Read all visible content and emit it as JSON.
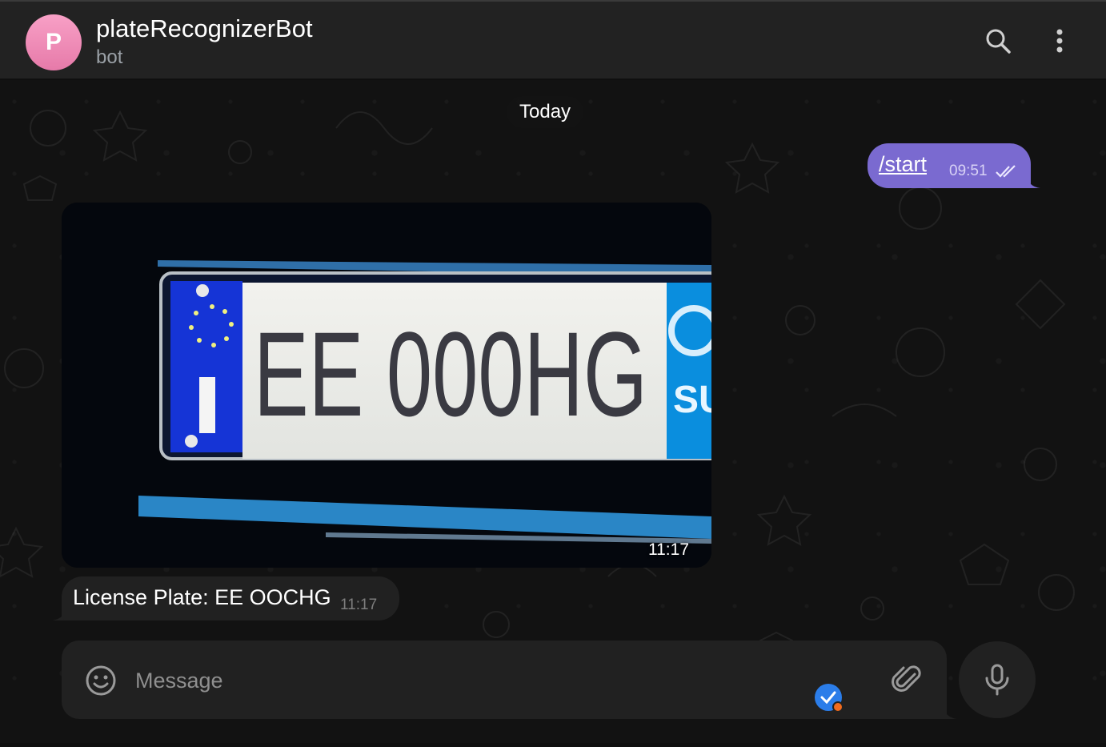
{
  "header": {
    "avatar_letter": "P",
    "avatar_colors": [
      "#f8a0c6",
      "#e67aa9"
    ],
    "title": "plateRecognizerBot",
    "subtitle": "bot",
    "icons": [
      "search-icon",
      "more-vertical-icon"
    ]
  },
  "chat": {
    "date_label": "Today",
    "messages": [
      {
        "direction": "outgoing",
        "text": "/start",
        "time": "09:51",
        "status": "read"
      },
      {
        "direction": "incoming",
        "type": "photo",
        "time": "11:17",
        "photo": {
          "plate_text": "EE 000HG",
          "plate_side_text": "SU"
        }
      },
      {
        "direction": "incoming",
        "text": "License Plate: EE OOCHG",
        "time": "11:17"
      }
    ]
  },
  "composer": {
    "placeholder": "Message",
    "value": "",
    "icons": [
      "emoji-icon",
      "paperclip-icon",
      "microphone-icon"
    ]
  },
  "colors": {
    "outgoing_bubble": "#7a6ad0",
    "incoming_bubble": "#212121",
    "header_bg": "#222222",
    "badge_blue": "#2b7de9",
    "badge_orange": "#f26b1d"
  }
}
